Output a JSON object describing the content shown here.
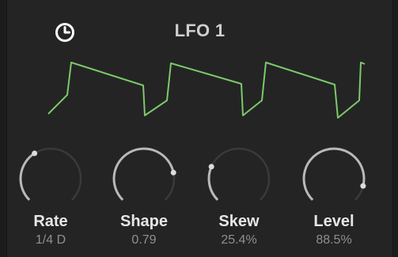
{
  "header": {
    "title": "LFO 1",
    "clock_icon": "clock-icon"
  },
  "colors": {
    "background": "#242424",
    "waveform": "#7cc96a",
    "knob_track": "#3a3a3a",
    "knob_arc": "#b9b9b9",
    "label": "#e6e6e6",
    "value": "#8f8f8f"
  },
  "knobs": [
    {
      "label": "Rate",
      "value": "1/4 D",
      "level": 0.38
    },
    {
      "label": "Shape",
      "value": "0.79",
      "level": 0.79
    },
    {
      "label": "Skew",
      "value": "25.4%",
      "level": 0.254
    },
    {
      "label": "Level",
      "value": "88.5%",
      "level": 0.885
    }
  ]
}
